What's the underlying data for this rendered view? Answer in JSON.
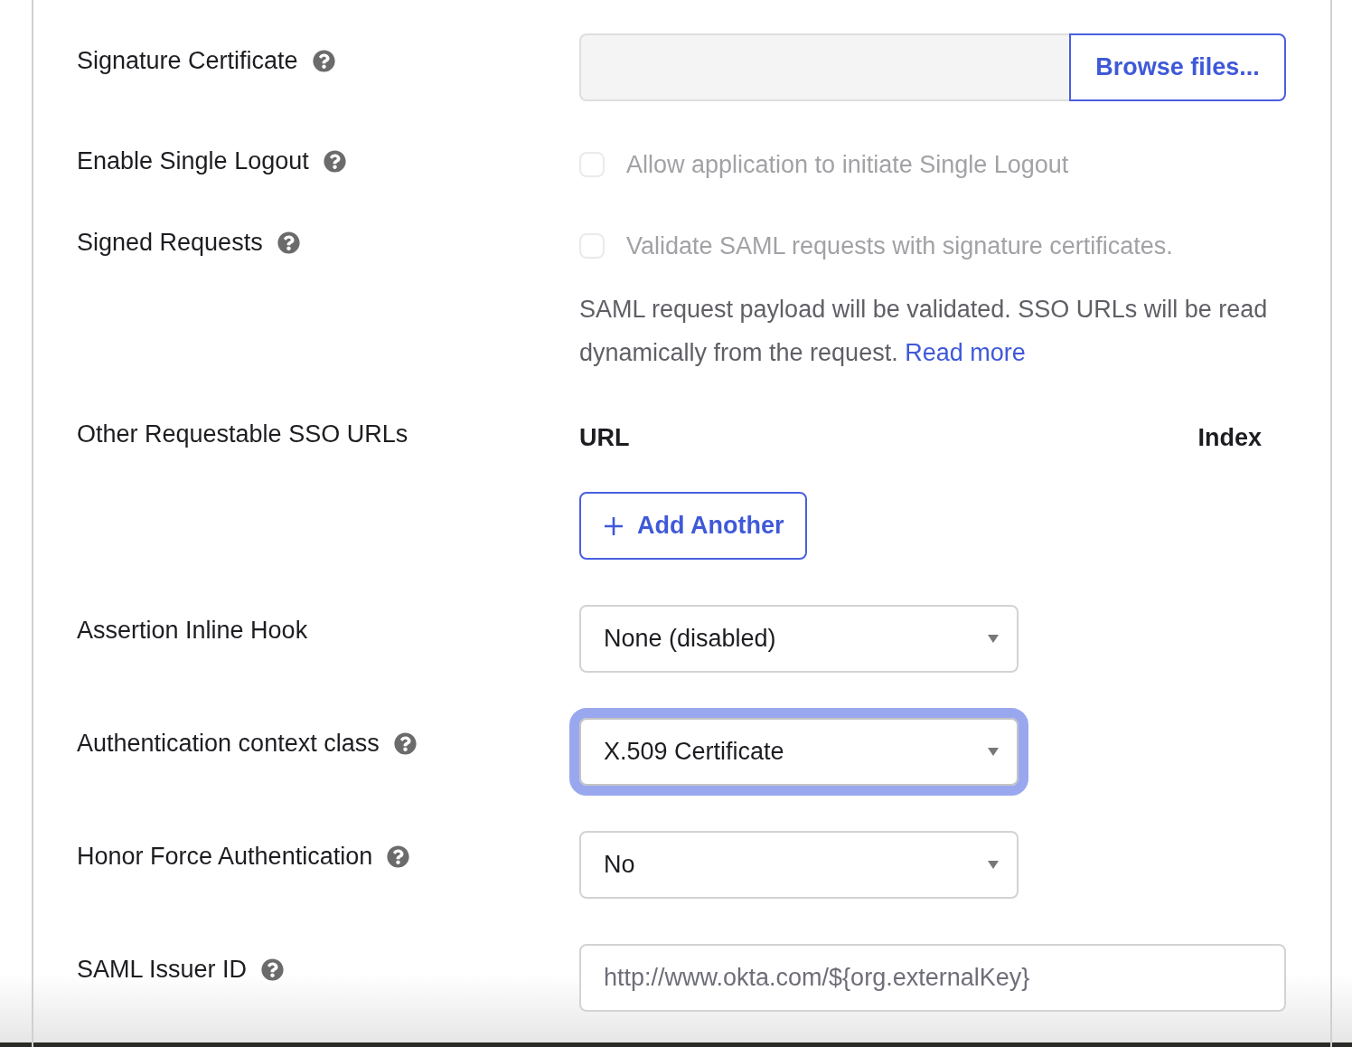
{
  "rows": [
    {
      "kind": "file",
      "label": "Signature Certificate",
      "help": true,
      "button": "Browse files..."
    },
    {
      "kind": "checkbox",
      "label": "Enable Single Logout",
      "help": true,
      "checkbox": {
        "label": "Allow application to initiate Single Logout",
        "checked": false,
        "disabled": true
      }
    },
    {
      "kind": "checkbox",
      "label": "Signed Requests",
      "help": true,
      "checkbox": {
        "label": "Validate SAML requests with signature certificates.",
        "checked": false,
        "disabled": true
      },
      "description": "SAML request payload will be validated. SSO URLs will be read dynamically from the request.",
      "link": "Read more"
    },
    {
      "kind": "url_table",
      "label": "Other Requestable SSO URLs",
      "help": false,
      "columns": [
        "URL",
        "Index"
      ],
      "button": "Add Another"
    },
    {
      "kind": "select",
      "label": "Assertion Inline Hook",
      "help": false,
      "value": "None (disabled)",
      "focused": false
    },
    {
      "kind": "select",
      "label": "Authentication context class",
      "help": true,
      "value": "X.509 Certificate",
      "focused": true
    },
    {
      "kind": "select",
      "label": "Honor Force Authentication",
      "help": true,
      "value": "No",
      "focused": false
    },
    {
      "kind": "text",
      "label": "SAML Issuer ID",
      "help": true,
      "placeholder": "http://www.okta.com/${org.externalKey}"
    }
  ]
}
